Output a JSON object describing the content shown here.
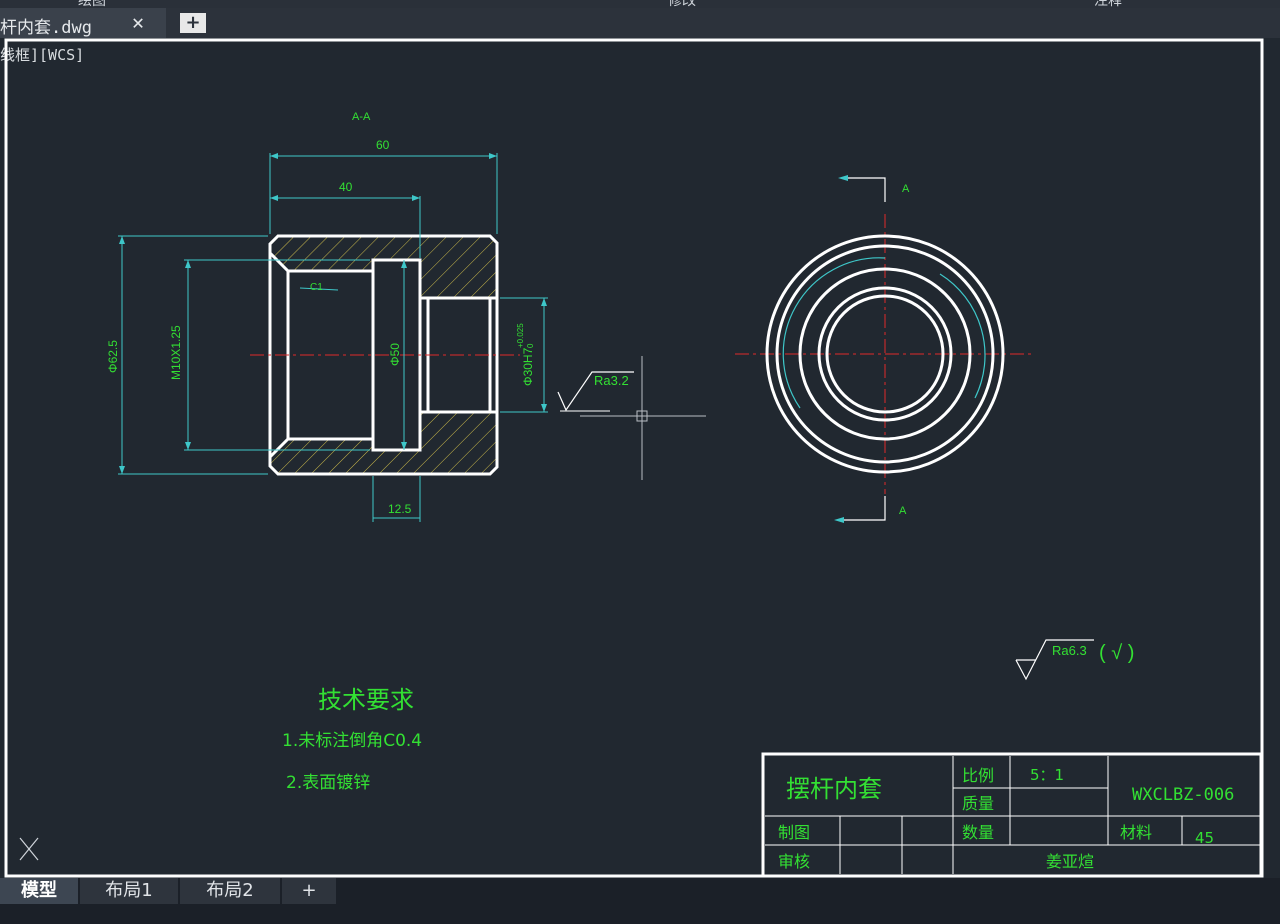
{
  "top_menu": {
    "draw": "绘图",
    "modify": "修改",
    "annotate": "注释"
  },
  "file_tab": {
    "name": "杆内套.dwg",
    "close_glyph": "✕",
    "new_glyph": "+"
  },
  "viewport_label": "线框][WCS]",
  "section_label": "A-A",
  "section_marks": [
    "A",
    "A"
  ],
  "dimensions": {
    "length_total": "60",
    "length_bore": "40",
    "outer_dia": "Φ62.5",
    "thread": "M10X1.25",
    "bore_dia": "Φ50",
    "small_bore": "Φ30H7",
    "tol_upper": "+0.025",
    "tol_lower": "0",
    "groove_width": "12.5",
    "chamfer": "C1"
  },
  "roughness": {
    "local": "Ra3.2",
    "general": "Ra6.3",
    "general_suffix": "( √ )"
  },
  "tech_req": {
    "title": "技术要求",
    "item1": "1.未标注倒角C0.4",
    "item2": "2.表面镀锌"
  },
  "title_block": {
    "part_name": "摆杆内套",
    "scale_label": "比例",
    "scale_value": "5：1",
    "mass_label": "质量",
    "drawing_no": "WXCLBZ-006",
    "drawn_label": "制图",
    "qty_label": "数量",
    "material_label": "材料",
    "material_value": "45",
    "review_label": "审核",
    "designer": "姜亚煊"
  },
  "layout_tabs": [
    "模型",
    "布局1",
    "布局2",
    "+"
  ],
  "colors": {
    "background": "#212830",
    "geometry": "#ffffff",
    "dimension": "#3ec7c9",
    "text": "#33e033",
    "centerline": "#e02a2a",
    "hatch": "#c9b84a"
  }
}
